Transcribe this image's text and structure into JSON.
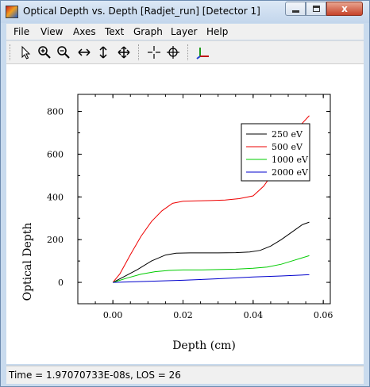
{
  "window": {
    "title": "Optical Depth vs. Depth [Radjet_run] [Detector 1]",
    "close_glyph": "x",
    "icons": {
      "app": "app-icon",
      "minimize": "minimize-icon",
      "maximize": "maximize-icon",
      "close": "close-icon"
    }
  },
  "menu": [
    "File",
    "View",
    "Axes",
    "Text",
    "Graph",
    "Layer",
    "Help"
  ],
  "toolbar": [
    {
      "icon": "pointer-icon"
    },
    {
      "icon": "zoom-in-icon"
    },
    {
      "icon": "zoom-out-icon"
    },
    {
      "icon": "pan-horizontal-icon"
    },
    {
      "icon": "pan-vertical-icon"
    },
    {
      "icon": "pan-all-icon"
    },
    {
      "icon": "crosshair-icon"
    },
    {
      "icon": "target-icon"
    },
    {
      "icon": "axes-icon"
    }
  ],
  "status": {
    "text": "Time = 1.97070733E-08s, LOS = 26"
  },
  "chart_data": {
    "type": "line",
    "xlabel": "Depth (cm)",
    "ylabel": "Optical Depth",
    "xlim": [
      -0.01,
      0.062
    ],
    "ylim": [
      -100,
      880
    ],
    "xticks": [
      "0.00",
      "0.02",
      "0.04",
      "0.06"
    ],
    "yticks": [
      "0",
      "200",
      "400",
      "600",
      "800"
    ],
    "legend_position": "top-right",
    "series": [
      {
        "name": "250 eV",
        "color": "#000000",
        "x": [
          0.0,
          0.003,
          0.007,
          0.011,
          0.015,
          0.018,
          0.022,
          0.026,
          0.03,
          0.035,
          0.039,
          0.042,
          0.045,
          0.048,
          0.051,
          0.054,
          0.056
        ],
        "y": [
          0,
          25,
          60,
          100,
          128,
          137,
          138,
          138,
          138,
          139,
          142,
          150,
          170,
          200,
          235,
          270,
          282
        ]
      },
      {
        "name": "500 eV",
        "color": "#ee0000",
        "x": [
          0.0,
          0.002,
          0.005,
          0.008,
          0.011,
          0.014,
          0.017,
          0.02,
          0.024,
          0.028,
          0.032,
          0.036,
          0.04,
          0.043,
          0.046,
          0.049,
          0.052,
          0.054,
          0.056
        ],
        "y": [
          0,
          40,
          130,
          215,
          285,
          335,
          370,
          380,
          382,
          383,
          385,
          392,
          405,
          450,
          520,
          600,
          680,
          745,
          780
        ]
      },
      {
        "name": "1000 eV",
        "color": "#00cc00",
        "x": [
          0.0,
          0.004,
          0.008,
          0.012,
          0.016,
          0.02,
          0.025,
          0.03,
          0.035,
          0.04,
          0.044,
          0.048,
          0.052,
          0.056
        ],
        "y": [
          0,
          20,
          38,
          50,
          56,
          58,
          58,
          60,
          62,
          66,
          72,
          85,
          105,
          125
        ]
      },
      {
        "name": "2000 eV",
        "color": "#0000cc",
        "x": [
          0.0,
          0.01,
          0.02,
          0.03,
          0.04,
          0.048,
          0.056
        ],
        "y": [
          0,
          5,
          10,
          17,
          25,
          30,
          36
        ]
      }
    ]
  }
}
